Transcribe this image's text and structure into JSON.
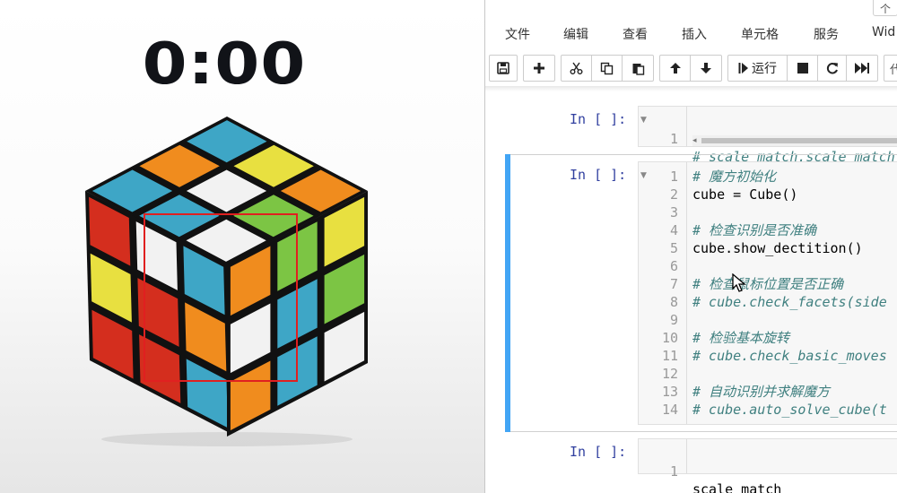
{
  "timer": {
    "display": "0:00"
  },
  "cube": {
    "colors": {
      "yellow": "#e8e040",
      "blue": "#3ea6c6",
      "orange": "#f08c1e",
      "white": "#f2f2f2",
      "green": "#7cc544",
      "red": "#d42e1e",
      "sticker_dark_orange": "#d4781a",
      "sticker_dark_green": "#5e9a32",
      "sticker_dark_blue": "#2f8fa8",
      "sticker_light_gray": "#d4d4d8",
      "frame": "#111111",
      "scan_box": "#e02020"
    },
    "top_face": [
      [
        "blue",
        "yellow",
        "orange"
      ],
      [
        "orange",
        "white",
        "green"
      ],
      [
        "blue",
        "blue",
        "white"
      ]
    ],
    "left_face": [
      [
        "red",
        "white",
        "blue"
      ],
      [
        "yellow",
        "red",
        "orange"
      ],
      [
        "red",
        "red",
        "blue"
      ]
    ],
    "right_face": [
      [
        "orange",
        "green",
        "yellow"
      ],
      [
        "white",
        "blue",
        "green"
      ],
      [
        "orange",
        "blue",
        "white"
      ]
    ]
  },
  "notebook": {
    "top_right_glyph": "个",
    "menu": [
      "文件",
      "编辑",
      "查看",
      "插入",
      "单元格",
      "服务",
      "Wid"
    ],
    "toolbar": {
      "save_icon": "floppy-icon",
      "add_icon": "plus-icon",
      "cut_icon": "scissors-icon",
      "copy_icon": "copy-icon",
      "paste_icon": "paste-icon",
      "up_icon": "arrow-up-icon",
      "down_icon": "arrow-down-icon",
      "run_label": "运行",
      "stop_icon": "stop-icon",
      "restart_icon": "restart-icon",
      "fast_forward_icon": "fast-forward-icon",
      "cell_type_partial": "代"
    },
    "cells": [
      {
        "prompt": "In [ ]:",
        "lines": [
          {
            "n": "1",
            "text": "# scale_match.scale_match",
            "comment": true
          }
        ]
      },
      {
        "prompt": "In [ ]:",
        "lines": [
          {
            "n": "1",
            "text": "# 魔方初始化",
            "comment": true
          },
          {
            "n": "2",
            "text": "cube = Cube()",
            "comment": false
          },
          {
            "n": "3",
            "text": "",
            "comment": false
          },
          {
            "n": "4",
            "text": "# 检查识别是否准确",
            "comment": true
          },
          {
            "n": "5",
            "text": "cube.show_dectition()",
            "comment": false
          },
          {
            "n": "6",
            "text": "",
            "comment": false
          },
          {
            "n": "7",
            "text": "# 检查鼠标位置是否正确",
            "comment": true
          },
          {
            "n": "8",
            "text": "# cube.check_facets(side",
            "comment": true
          },
          {
            "n": "9",
            "text": "",
            "comment": false
          },
          {
            "n": "10",
            "text": "# 检验基本旋转",
            "comment": true
          },
          {
            "n": "11",
            "text": "# cube.check_basic_moves",
            "comment": true
          },
          {
            "n": "12",
            "text": "",
            "comment": false
          },
          {
            "n": "13",
            "text": "# 自动识别并求解魔方",
            "comment": true
          },
          {
            "n": "14",
            "text": "# cube.auto_solve_cube(t",
            "comment": true
          }
        ]
      },
      {
        "prompt": "In [ ]:",
        "lines": [
          {
            "n": "1",
            "text": "scale_match",
            "comment": false
          }
        ]
      }
    ],
    "colors": {
      "prompt": "#303f9f",
      "comment": "#408080",
      "selected_bar": "#42a5f5"
    }
  }
}
